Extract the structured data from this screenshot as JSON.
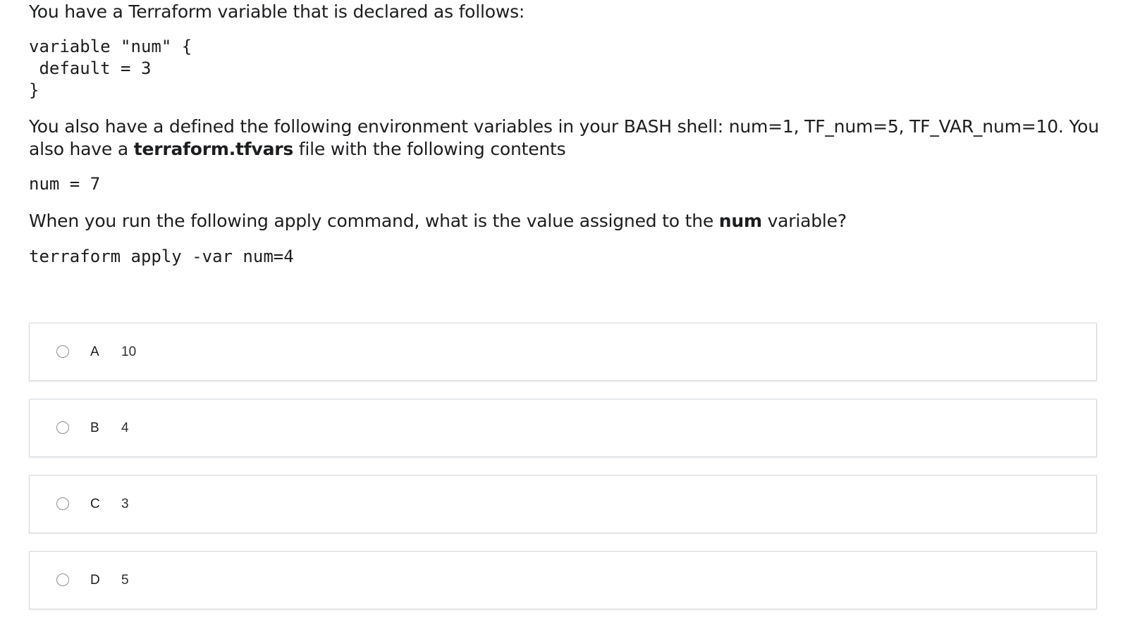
{
  "question": {
    "intro": "You have a Terraform variable that is declared as follows:",
    "code_var_line1": "variable \"num\" {",
    "code_var_line2": " default = 3",
    "code_var_line3": "}",
    "env_text": "You also have a defined the following environment variables in your BASH shell: num=1, TF_num=5, TF_VAR_num=10. You also have a ",
    "env_bold": "terraform.tfvars",
    "env_tail": " file with the following contents",
    "tfvars_code": "num = 7",
    "ask_text": "When you run the following apply command, what is the value assigned to the ",
    "ask_bold": "num",
    "ask_tail": " variable?",
    "command": "terraform apply -var num=4"
  },
  "answers": [
    {
      "letter": "A",
      "value": "10"
    },
    {
      "letter": "B",
      "value": "4"
    },
    {
      "letter": "C",
      "value": "3"
    },
    {
      "letter": "D",
      "value": "5"
    }
  ]
}
